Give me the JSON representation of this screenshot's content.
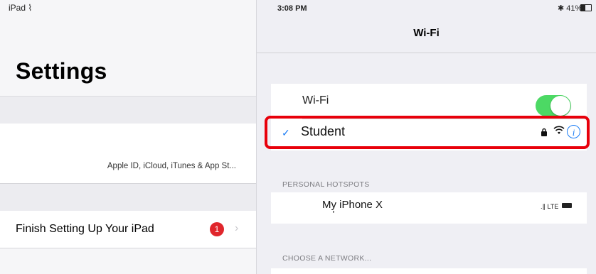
{
  "status_bar": {
    "carrier": "iPad ⌇",
    "time": "3:08 PM",
    "right": "✱ 41%"
  },
  "master": {
    "title": "Settings",
    "apple_id_subtitle": "Apple ID, iCloud, iTunes & App St...",
    "finish_setup_label": "Finish Setting Up Your iPad",
    "finish_setup_badge": "1",
    "chevron": "›"
  },
  "detail": {
    "nav_title": "Wi-Fi",
    "wifi_label": "Wi-Fi",
    "wifi_enabled": true,
    "connected_network": {
      "name": "Student",
      "checkmark": "✓",
      "lock": "🔒",
      "signal": "⌇",
      "info": "i"
    },
    "personal_hotspots_header": "PERSONAL HOTSPOTS",
    "hotspot_name": "My̦ iPhone X",
    "hotspot_status": ".∥ LTE",
    "choose_network_header": "CHOOSE A NETWORK..."
  },
  "colors": {
    "toggle_on": "#4cd964",
    "highlight": "#e8000b",
    "accent": "#1a7cf5",
    "badge": "#e0262c"
  }
}
